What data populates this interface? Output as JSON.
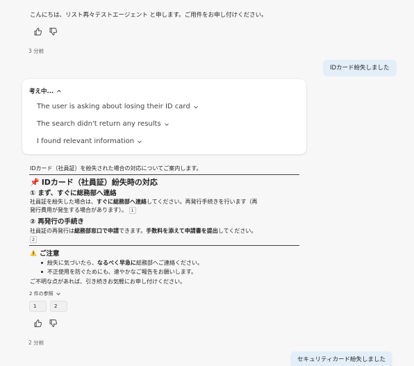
{
  "messages": {
    "greeting": "こんにちは、リスト再々テストエージェント と申します。ご用件をお申し付けください。",
    "greeting_time": "3 分前",
    "user_1": "IDカード紛失しました",
    "thinking": {
      "header": "考え中...",
      "steps": [
        "The user is asking about losing their ID card",
        "The search didn't return any results",
        "I found relevant information"
      ]
    },
    "answer": {
      "intro": "IDカード（社員証）を紛失された場合の対応についてご案内します。",
      "title_emoji": "📌",
      "title": "IDカード（社員証）紛失時の対応",
      "step1_heading": "① まず、すぐに総務部へ連絡",
      "step1_a": "社員証を紛失した場合は、",
      "step1_b": "すぐに総務部へ連絡",
      "step1_c": "してください。再発行手続きを行います（再",
      "step1_line2": "発行費用が発生する場合があります）。",
      "step1_cite": "1",
      "step2_heading": "② 再発行の手続き",
      "step2_a": "社員証の再発行は",
      "step2_b": "総務部窓口で申請",
      "step2_c": "できます。",
      "step2_d": "手数料を添えて申請書を提出",
      "step2_e": "してください。",
      "step2_cite": "2",
      "caution_emoji": "⚠️",
      "caution_heading": "ご注意",
      "bullet1_a": "紛失に気づいたら、",
      "bullet1_b": "なるべく早急に",
      "bullet1_c": "総務部へご連絡ください。",
      "bullet2": "不正使用を防ぐためにも、速やかなご報告をお願いします。",
      "closing": "ご不明な点があれば、引き続きお気軽にお申し付けください。",
      "refs_label": "2 件の参照",
      "ref_1": "1",
      "ref_2": "2",
      "time": "2 分前"
    },
    "user_2": "セキュリティカード紛失しました"
  },
  "colors": {
    "background": "#f7f7f8",
    "user_bubble": "#e3eef9",
    "card": "#ffffff",
    "text": "#242424"
  },
  "icons": {
    "like": "thumbs-up-icon",
    "dislike": "thumbs-down-icon",
    "chevron_up": "chevron-up-icon",
    "chevron_down": "chevron-down-icon"
  }
}
